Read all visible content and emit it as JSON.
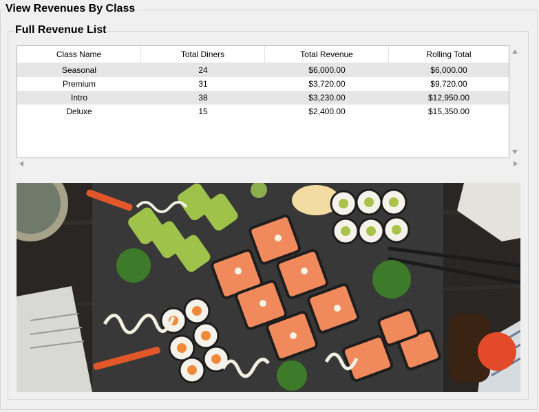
{
  "window": {
    "title": "View Revenues By Class"
  },
  "group": {
    "title": "Full Revenue List"
  },
  "table": {
    "columns": [
      "Class Name",
      "Total Diners",
      "Total Revenue",
      "Rolling Total"
    ],
    "rows": [
      [
        "Seasonal",
        "24",
        "$6,000.00",
        "$6,000.00"
      ],
      [
        "Premium",
        "31",
        "$3,720.00",
        "$9,720.00"
      ],
      [
        "Intro",
        "38",
        "$3,230.00",
        "$12,950.00"
      ],
      [
        "Deluxe",
        "15",
        "$2,400.00",
        "$15,350.00"
      ]
    ]
  },
  "image": {
    "subject": "sushi-platter"
  },
  "colors": {
    "row_alt": "#e6e6e6",
    "salmon": "#f08a5d",
    "slate": "#3a3a3a"
  }
}
